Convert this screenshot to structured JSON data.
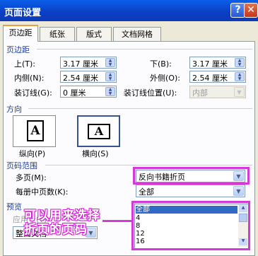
{
  "window": {
    "title": "页面设置",
    "help": "?",
    "close": "✕"
  },
  "tabs": [
    {
      "label": "页边距",
      "active": true
    },
    {
      "label": "纸张",
      "active": false
    },
    {
      "label": "版式",
      "active": false
    },
    {
      "label": "文档网格",
      "active": false
    }
  ],
  "margins": {
    "section": "页边距",
    "top_label": "上(T):",
    "top_value": "3.17 厘米",
    "bottom_label": "下(B):",
    "bottom_value": "3.17 厘米",
    "inside_label": "内侧(N):",
    "inside_value": "2.54 厘米",
    "outside_label": "外侧(O):",
    "outside_value": "2.54 厘米",
    "gutter_label": "装订线(G):",
    "gutter_value": "0 厘米",
    "gutter_pos_label": "装订线位置(U):",
    "gutter_pos_value": "内部"
  },
  "orientation": {
    "section": "方向",
    "portrait_label": "纵向(P)",
    "landscape_label": "横向(S)",
    "icon_letter": "A"
  },
  "pages": {
    "section": "页码范围",
    "multiple_label": "多页(M):",
    "multiple_value": "反向书籍折页",
    "per_booklet_label": "每册中页数(K):",
    "per_booklet_value": "全部",
    "list_options": [
      "全部",
      "4",
      "8",
      "12",
      "16"
    ],
    "selected_option": "全部"
  },
  "preview": {
    "section": "预览",
    "apply_label": "应用于(Y):",
    "apply_value": "整篇文档"
  },
  "annotation": {
    "line1": "可以用来选择",
    "line2": "折页的页码",
    "color": "#d63ad6"
  }
}
